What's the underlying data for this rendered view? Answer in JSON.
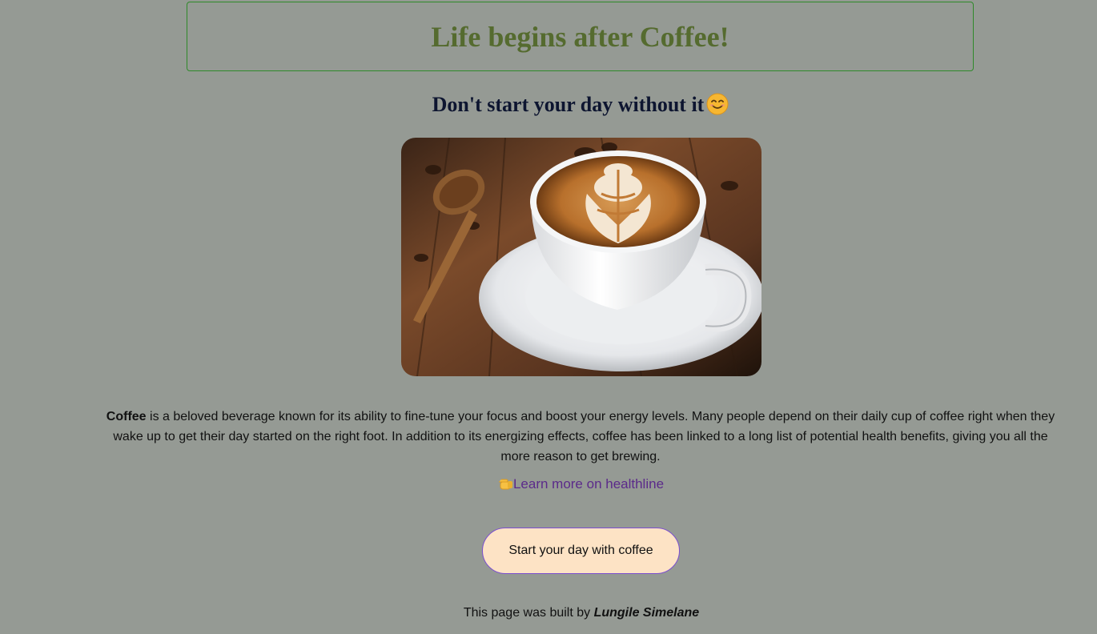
{
  "header": {
    "title": "Life begins after Coffee!",
    "subtitle": "Don't start your day without it"
  },
  "image": {
    "icon": "coffee-latte-photo"
  },
  "description": {
    "bold_word": "Coffee",
    "text": " is a beloved beverage known for its ability to fine-tune your focus and boost your energy levels. Many people depend on their daily cup of coffee right when they wake up to get their day started on the right foot. In addition to its energizing effects, coffee has been linked to a long list of potential health benefits, giving you all the more reason to get brewing."
  },
  "link": {
    "label": "Learn more on healthline",
    "icon": "pointing-hand-icon"
  },
  "button": {
    "label": "Start your day with coffee"
  },
  "footer": {
    "prefix": "This page was built by ",
    "author": "Lungile Simelane"
  },
  "colors": {
    "background": "#959a94",
    "title": "#556b2f",
    "title_border": "#2f8a2a",
    "link": "#5b2a8a",
    "button_bg": "#fde3c5",
    "button_border": "#7b4fd0"
  }
}
